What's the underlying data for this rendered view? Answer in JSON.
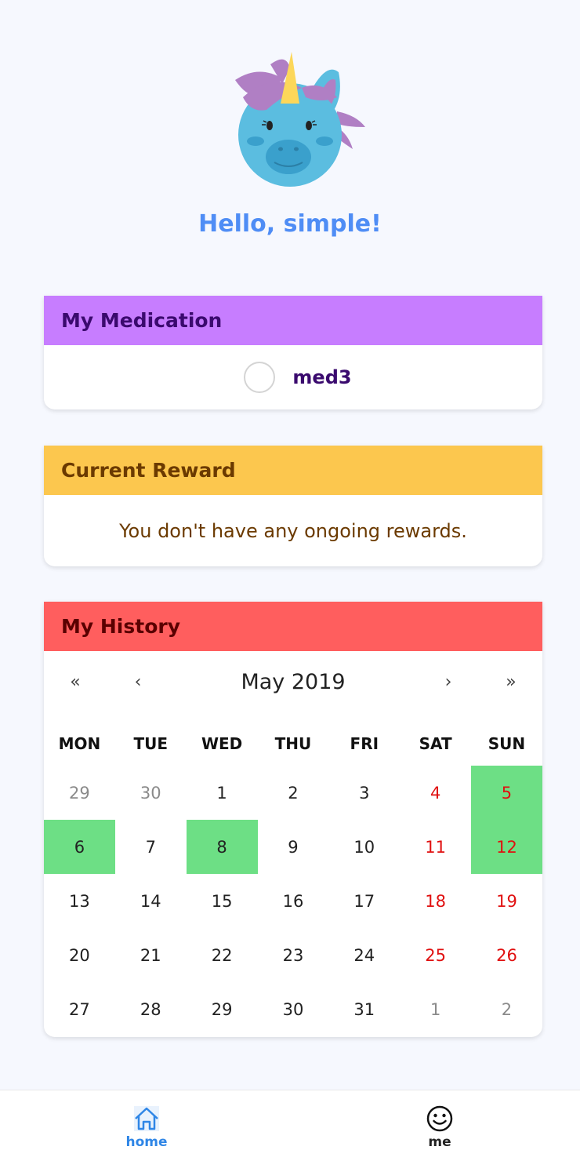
{
  "greeting": "Hello, simple!",
  "medication": {
    "title": "My Medication",
    "items": [
      {
        "name": "med3",
        "checked": false
      }
    ]
  },
  "reward": {
    "title": "Current Reward",
    "message": "You don't have any ongoing rewards."
  },
  "history": {
    "title": "My History",
    "nav": {
      "prev_year": "«",
      "prev_month": "‹",
      "month_label": "May 2019",
      "next_month": "›",
      "next_year": "»"
    },
    "weekdays": [
      "MON",
      "TUE",
      "WED",
      "THU",
      "FRI",
      "SAT",
      "SUN"
    ],
    "days": [
      {
        "label": "29",
        "other": true
      },
      {
        "label": "30",
        "other": true
      },
      {
        "label": "1"
      },
      {
        "label": "2"
      },
      {
        "label": "3"
      },
      {
        "label": "4",
        "weekend": true
      },
      {
        "label": "5",
        "weekend": true,
        "taken": true
      },
      {
        "label": "6",
        "taken": true
      },
      {
        "label": "7"
      },
      {
        "label": "8",
        "taken": true
      },
      {
        "label": "9"
      },
      {
        "label": "10"
      },
      {
        "label": "11",
        "weekend": true
      },
      {
        "label": "12",
        "weekend": true,
        "taken": true
      },
      {
        "label": "13"
      },
      {
        "label": "14"
      },
      {
        "label": "15"
      },
      {
        "label": "16"
      },
      {
        "label": "17"
      },
      {
        "label": "18",
        "weekend": true
      },
      {
        "label": "19",
        "weekend": true
      },
      {
        "label": "20"
      },
      {
        "label": "21"
      },
      {
        "label": "22"
      },
      {
        "label": "23"
      },
      {
        "label": "24"
      },
      {
        "label": "25",
        "weekend": true
      },
      {
        "label": "26",
        "weekend": true
      },
      {
        "label": "27"
      },
      {
        "label": "28"
      },
      {
        "label": "29"
      },
      {
        "label": "30"
      },
      {
        "label": "31"
      },
      {
        "label": "1",
        "other": true
      },
      {
        "label": "2",
        "other": true
      }
    ]
  },
  "tabs": {
    "home": {
      "label": "home",
      "icon": "home-icon",
      "active": true
    },
    "me": {
      "label": "me",
      "icon": "smiley-icon",
      "active": false
    }
  },
  "colors": {
    "accent": "#4f8df5",
    "medication_header": "#c77dff",
    "reward_header": "#fcc74e",
    "history_header": "#ff5e5e",
    "taken_day": "#6ddf85",
    "weekend_text": "#e01010"
  }
}
